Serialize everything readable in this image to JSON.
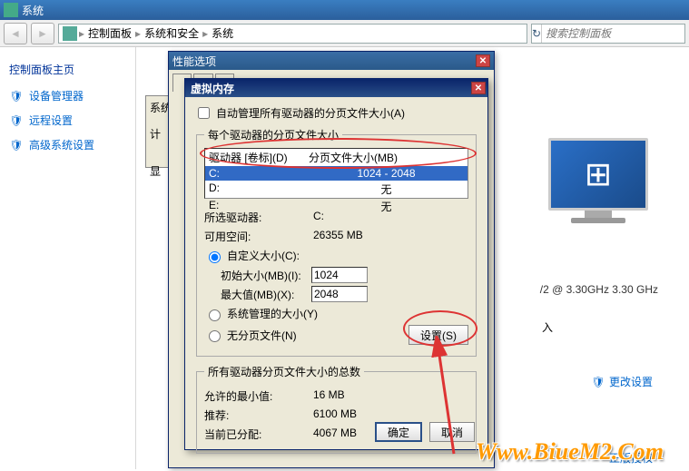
{
  "window": {
    "title": "系统"
  },
  "nav": {
    "breadcrumb": [
      "控制面板",
      "系统和安全",
      "系统"
    ],
    "search_placeholder": "搜索控制面板"
  },
  "sidebar": {
    "title": "控制面板主页",
    "items": [
      {
        "label": "设备管理器",
        "icon": "shield-icon"
      },
      {
        "label": "远程设置",
        "icon": "shield-icon"
      },
      {
        "label": "高级系统设置",
        "icon": "shield-icon"
      }
    ]
  },
  "main": {
    "cpu_text": "/2 @ 3.30GHz   3.30 GHz",
    "pen_input": "入",
    "change_settings": "更改设置",
    "legal": "正版授权"
  },
  "sys_props_peek": {
    "l1": "系统",
    "l2": "计",
    "l3": "显"
  },
  "perf_dialog": {
    "title": "性能选项"
  },
  "vm_dialog": {
    "title": "虚拟内存",
    "auto_manage": "自动管理所有驱动器的分页文件大小(A)",
    "drives_legend": "每个驱动器的分页文件大小",
    "header": {
      "drive": "驱动器 [卷标](D)",
      "size": "分页文件大小(MB)"
    },
    "drives": [
      {
        "letter": "C:",
        "paging": "1024 - 2048",
        "selected": true
      },
      {
        "letter": "D:",
        "paging": "无",
        "selected": false
      },
      {
        "letter": "E:",
        "paging": "无",
        "selected": false
      }
    ],
    "selected_drive_label": "所选驱动器:",
    "selected_drive_value": "C:",
    "avail_space_label": "可用空间:",
    "avail_space_value": "26355 MB",
    "custom_size_label": "自定义大小(C):",
    "initial_size_label": "初始大小(MB)(I):",
    "initial_size_value": "1024",
    "max_size_label": "最大值(MB)(X):",
    "max_size_value": "2048",
    "system_managed_label": "系统管理的大小(Y)",
    "no_paging_label": "无分页文件(N)",
    "set_button": "设置(S)",
    "totals_legend": "所有驱动器分页文件大小的总数",
    "min_allowed_label": "允许的最小值:",
    "min_allowed_value": "16 MB",
    "recommended_label": "推荐:",
    "recommended_value": "6100 MB",
    "current_label": "当前已分配:",
    "current_value": "4067 MB",
    "ok": "确定",
    "cancel": "取消"
  },
  "watermark": "Www.BiueM2.Com"
}
